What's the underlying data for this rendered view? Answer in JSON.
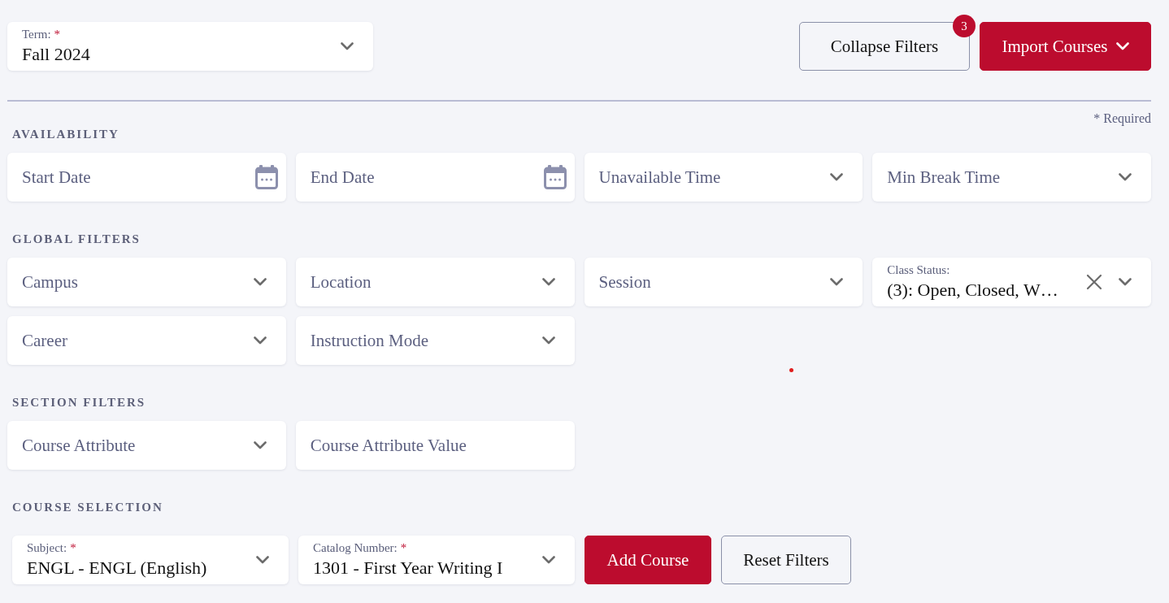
{
  "term": {
    "kind": "select",
    "label": "Term:",
    "required": true,
    "value": "Fall 2024"
  },
  "required_marker": "*",
  "toolbar": {
    "buttons": [
      {
        "kind": "outline",
        "label": "Collapse Filters",
        "badge": "3",
        "menu": false
      },
      {
        "kind": "primary",
        "label": "Import Courses",
        "menu": true
      }
    ]
  },
  "required_note": "* Required",
  "sections": [
    {
      "title": "AVAILABILITY",
      "fields": [
        {
          "kind": "date",
          "placeholder": "Start Date"
        },
        {
          "kind": "date",
          "placeholder": "End Date"
        },
        {
          "kind": "select",
          "placeholder": "Unavailable Time"
        },
        {
          "kind": "select",
          "placeholder": "Min Break Time"
        }
      ]
    },
    {
      "title": "GLOBAL FILTERS",
      "fields": [
        {
          "kind": "select",
          "placeholder": "Campus"
        },
        {
          "kind": "select",
          "placeholder": "Location"
        },
        {
          "kind": "select",
          "placeholder": "Session"
        },
        {
          "kind": "multiselect",
          "label": "Class Status:",
          "required": false,
          "value": "(3): Open, Closed, W…",
          "clearable": true
        },
        {
          "kind": "select",
          "placeholder": "Career"
        },
        {
          "kind": "select",
          "placeholder": "Instruction Mode"
        }
      ]
    },
    {
      "title": "SECTION FILTERS",
      "fields": [
        {
          "kind": "select",
          "placeholder": "Course Attribute"
        },
        {
          "kind": "text",
          "placeholder": "Course Attribute Value"
        }
      ]
    }
  ],
  "course_selection": {
    "title": "COURSE SELECTION",
    "fields": [
      {
        "kind": "select",
        "label": "Subject:",
        "required": true,
        "value": "ENGL - ENGL (English)"
      },
      {
        "kind": "select",
        "label": "Catalog Number:",
        "required": true,
        "value": "1301 - First Year Writing I"
      }
    ],
    "buttons": [
      {
        "kind": "primary",
        "label": "Add Course",
        "menu": false
      },
      {
        "kind": "outline",
        "label": "Reset Filters",
        "menu": false
      }
    ]
  }
}
